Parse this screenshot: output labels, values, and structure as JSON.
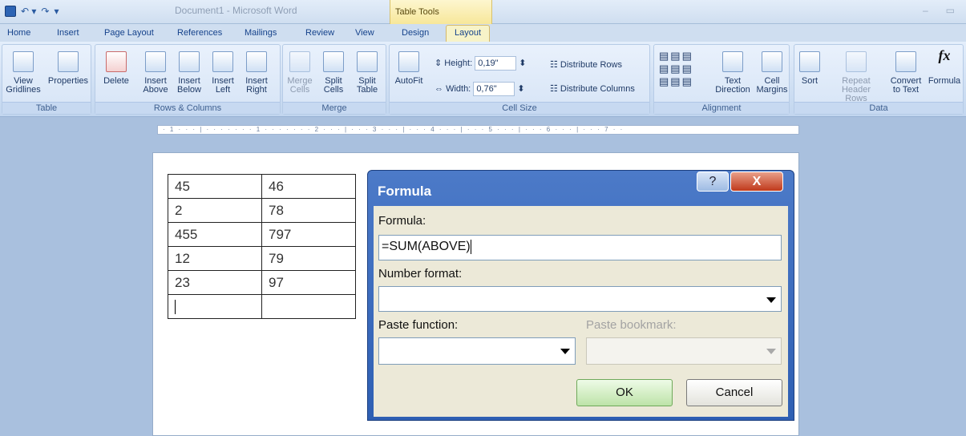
{
  "window": {
    "title": "Document1 - Microsoft Word",
    "context_tab": "Table Tools"
  },
  "tabs": [
    "Home",
    "Insert",
    "Page Layout",
    "References",
    "Mailings",
    "Review",
    "View",
    "Design",
    "Layout"
  ],
  "ribbon": {
    "table": {
      "label": "Table",
      "view_gridlines": "View Gridlines",
      "properties": "Properties"
    },
    "rows_columns": {
      "label": "Rows & Columns",
      "delete": "Delete",
      "insert_above": "Insert Above",
      "insert_below": "Insert Below",
      "insert_left": "Insert Left",
      "insert_right": "Insert Right"
    },
    "merge": {
      "label": "Merge",
      "merge_cells": "Merge Cells",
      "split_cells": "Split Cells",
      "split_table": "Split Table"
    },
    "cell_size": {
      "label": "Cell Size",
      "autofit": "AutoFit",
      "height_label": "Height:",
      "height_value": "0,19\"",
      "width_label": "Width:",
      "width_value": "0,76\"",
      "distribute_rows": "Distribute Rows",
      "distribute_columns": "Distribute Columns"
    },
    "alignment": {
      "label": "Alignment",
      "text_direction": "Text Direction",
      "cell_margins": "Cell Margins"
    },
    "data": {
      "label": "Data",
      "sort": "Sort",
      "repeat_header_rows": "Repeat Header Rows",
      "convert_to_text": "Convert to Text",
      "formula": "Formula"
    }
  },
  "ruler_text": "· 1 · · · | · · · · · · · 1 · · · · · · · 2 · · · | · · · 3 · · · | · · · 4 · · · | · · · 5 · · · | · · · 6 · · · | · · · 7 · ·",
  "document_table": [
    [
      "45",
      "46"
    ],
    [
      "2",
      "78"
    ],
    [
      "455",
      "797"
    ],
    [
      "12",
      "79"
    ],
    [
      "23",
      "97"
    ],
    [
      "",
      ""
    ]
  ],
  "dialog": {
    "title": "Formula",
    "help": "?",
    "close": "X",
    "formula_label": "Formula:",
    "formula_value": "=SUM(ABOVE)",
    "number_format_label": "Number format:",
    "paste_function_label": "Paste function:",
    "paste_bookmark_label": "Paste bookmark:",
    "ok": "OK",
    "cancel": "Cancel"
  },
  "colors": {
    "ribbon_bg": "#cfdef0",
    "dialog_title_bg": "#2e5fb3",
    "ok_button": "#bde3a8"
  }
}
